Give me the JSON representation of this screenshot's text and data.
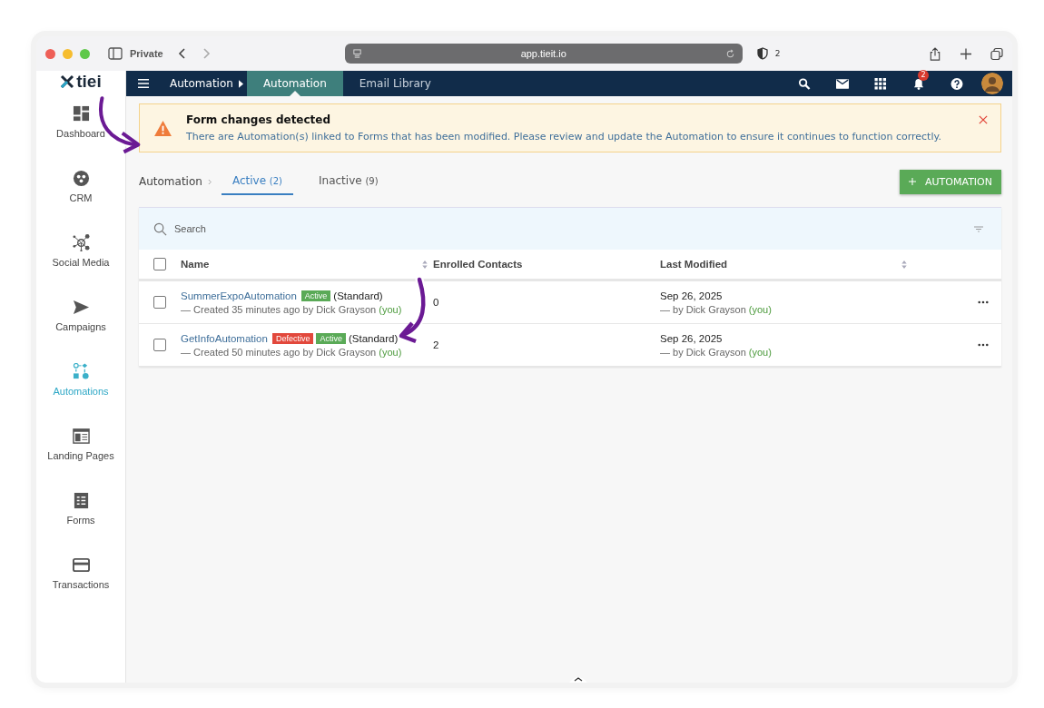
{
  "browser": {
    "mode": "Private",
    "url": "app.tieit.io",
    "shield_count": "2"
  },
  "logo": {
    "text": "tiei"
  },
  "topbar": {
    "crumb": "Automation",
    "tabs": [
      {
        "label": "Automation",
        "selected": true
      },
      {
        "label": "Email Library",
        "selected": false
      }
    ],
    "notification_count": "2"
  },
  "sidebar": {
    "items": [
      {
        "label": "Dashboard",
        "selected": false
      },
      {
        "label": "CRM",
        "selected": false
      },
      {
        "label": "Social Media",
        "selected": false
      },
      {
        "label": "Campaigns",
        "selected": false
      },
      {
        "label": "Automations",
        "selected": true
      },
      {
        "label": "Landing Pages",
        "selected": false
      },
      {
        "label": "Forms",
        "selected": false
      },
      {
        "label": "Transactions",
        "selected": false
      }
    ]
  },
  "alert": {
    "title": "Form changes detected",
    "message": "There are Automation(s) linked to Forms that has been modified. Please review and update the Automation to ensure it continues to function correctly."
  },
  "subnav": {
    "crumb": "Automation",
    "tabs": [
      {
        "label": "Active",
        "count": "(2)",
        "selected": true
      },
      {
        "label": "Inactive",
        "count": "(9)",
        "selected": false
      }
    ],
    "add_button": "AUTOMATION"
  },
  "search": {
    "placeholder": "Search"
  },
  "table": {
    "all_checked": false,
    "columns": [
      "Name",
      "Enrolled Contacts",
      "Last Modified"
    ],
    "rows": [
      {
        "name": "SummerExpoAutomation",
        "badges": [
          {
            "label": "Active",
            "kind": "active"
          }
        ],
        "type": "(Standard)",
        "created": "— Created 35 minutes ago by Dick Grayson",
        "you": "(you)",
        "enrolled": "0",
        "modified": "Sep 26, 2025",
        "modified_by": "— by Dick Grayson",
        "modified_you": "(you)",
        "checked": false
      },
      {
        "name": "GetInfoAutomation",
        "badges": [
          {
            "label": "Defective",
            "kind": "defective"
          },
          {
            "label": "Active",
            "kind": "active"
          }
        ],
        "type": "(Standard)",
        "created": "— Created 50 minutes ago by Dick Grayson",
        "you": "(you)",
        "enrolled": "2",
        "modified": "Sep 26, 2025",
        "modified_by": "— by Dick Grayson",
        "modified_you": "(you)",
        "checked": false
      }
    ]
  }
}
